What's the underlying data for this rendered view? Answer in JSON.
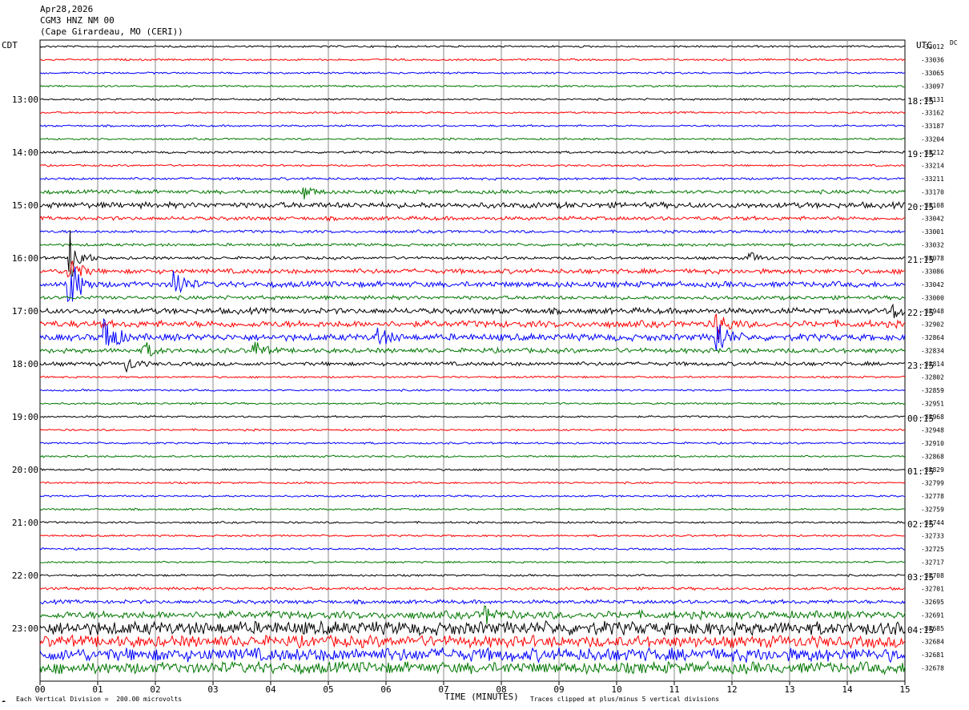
{
  "header": {
    "date": "Apr28,2026",
    "station": "CGM3 HNZ NM 00",
    "location": "(Cape Girardeau, MO (CERI))"
  },
  "axes": {
    "left_tz": "CDT",
    "right_tz": "UTC",
    "dc_label": "DC",
    "xlabel": "TIME (MINUTES)"
  },
  "footer": {
    "scale_note": "Each Vertical Division =  200.00 microvolts",
    "clip_note": "Traces clipped at plus/minus 5 vertical divisions"
  },
  "colors": {
    "trace_cycle": [
      "#000000",
      "#ff0000",
      "#0000ff",
      "#007700"
    ],
    "grid": "#888888"
  },
  "chart_data": {
    "type": "line",
    "title": "CGM3 HNZ NM 00",
    "xlim": [
      0,
      15
    ],
    "x_ticks": [
      "00",
      "01",
      "02",
      "03",
      "04",
      "05",
      "06",
      "07",
      "08",
      "09",
      "10",
      "11",
      "12",
      "13",
      "14",
      "15"
    ],
    "left_hour_labels": [
      "13:00",
      "14:00",
      "15:00",
      "16:00",
      "17:00",
      "18:00",
      "19:00",
      "20:00",
      "21:00",
      "22:00",
      "23:00"
    ],
    "right_hour_labels": [
      "18:15",
      "19:15",
      "20:15",
      "21:15",
      "22:15",
      "23:15",
      "00:15",
      "01:15",
      "02:15",
      "03:15",
      "04:15"
    ],
    "dc_offsets": [
      -33012,
      -33036,
      -33065,
      -33097,
      -33131,
      -33162,
      -33187,
      -33204,
      -33212,
      -33214,
      -33211,
      -33170,
      -33108,
      -33042,
      -33001,
      -33032,
      -33078,
      -33086,
      -33042,
      -33000,
      -32948,
      -32902,
      -32864,
      -32834,
      -32814,
      -32802,
      -32859,
      -32951,
      -32968,
      -32948,
      -32910,
      -32868,
      -32829,
      -32799,
      -32778,
      -32759,
      -32744,
      -32733,
      -32725,
      -32717,
      -32708,
      -32701,
      -32695,
      -32691,
      -32685,
      -32684,
      -32681,
      -32678
    ],
    "noise_levels": [
      1,
      1,
      1,
      1,
      1,
      1,
      1,
      1,
      1.2,
      1,
      1.3,
      2,
      3,
      2,
      1.5,
      1.5,
      1.5,
      2.5,
      3,
      2,
      3,
      3.5,
      3.5,
      2.5,
      2,
      1,
      1,
      1,
      1,
      1,
      1,
      1,
      1,
      1,
      1,
      1,
      1,
      1,
      1,
      1,
      1,
      1.5,
      2,
      4,
      7,
      6,
      7,
      6
    ],
    "events": [
      {
        "trace": 16,
        "minute": 0.52,
        "amplitude": 35
      },
      {
        "trace": 17,
        "minute": 0.5,
        "amplitude": 25
      },
      {
        "trace": 18,
        "minute": 0.5,
        "amplitude": 45
      },
      {
        "trace": 18,
        "minute": 2.32,
        "amplitude": 25
      },
      {
        "trace": 21,
        "minute": 11.72,
        "amplitude": 20
      },
      {
        "trace": 22,
        "minute": 11.72,
        "amplitude": 30
      },
      {
        "trace": 22,
        "minute": 1.12,
        "amplitude": 35
      },
      {
        "trace": 22,
        "minute": 5.85,
        "amplitude": 15
      },
      {
        "trace": 23,
        "minute": 1.8,
        "amplitude": 12
      },
      {
        "trace": 23,
        "minute": 3.7,
        "amplitude": 14
      },
      {
        "trace": 24,
        "minute": 1.5,
        "amplitude": 10
      },
      {
        "trace": 20,
        "minute": 14.8,
        "amplitude": 10
      },
      {
        "trace": 16,
        "minute": 12.3,
        "amplitude": 8
      },
      {
        "trace": 11,
        "minute": 4.55,
        "amplitude": 10
      },
      {
        "trace": 43,
        "minute": 7.72,
        "amplitude": 12
      }
    ]
  }
}
